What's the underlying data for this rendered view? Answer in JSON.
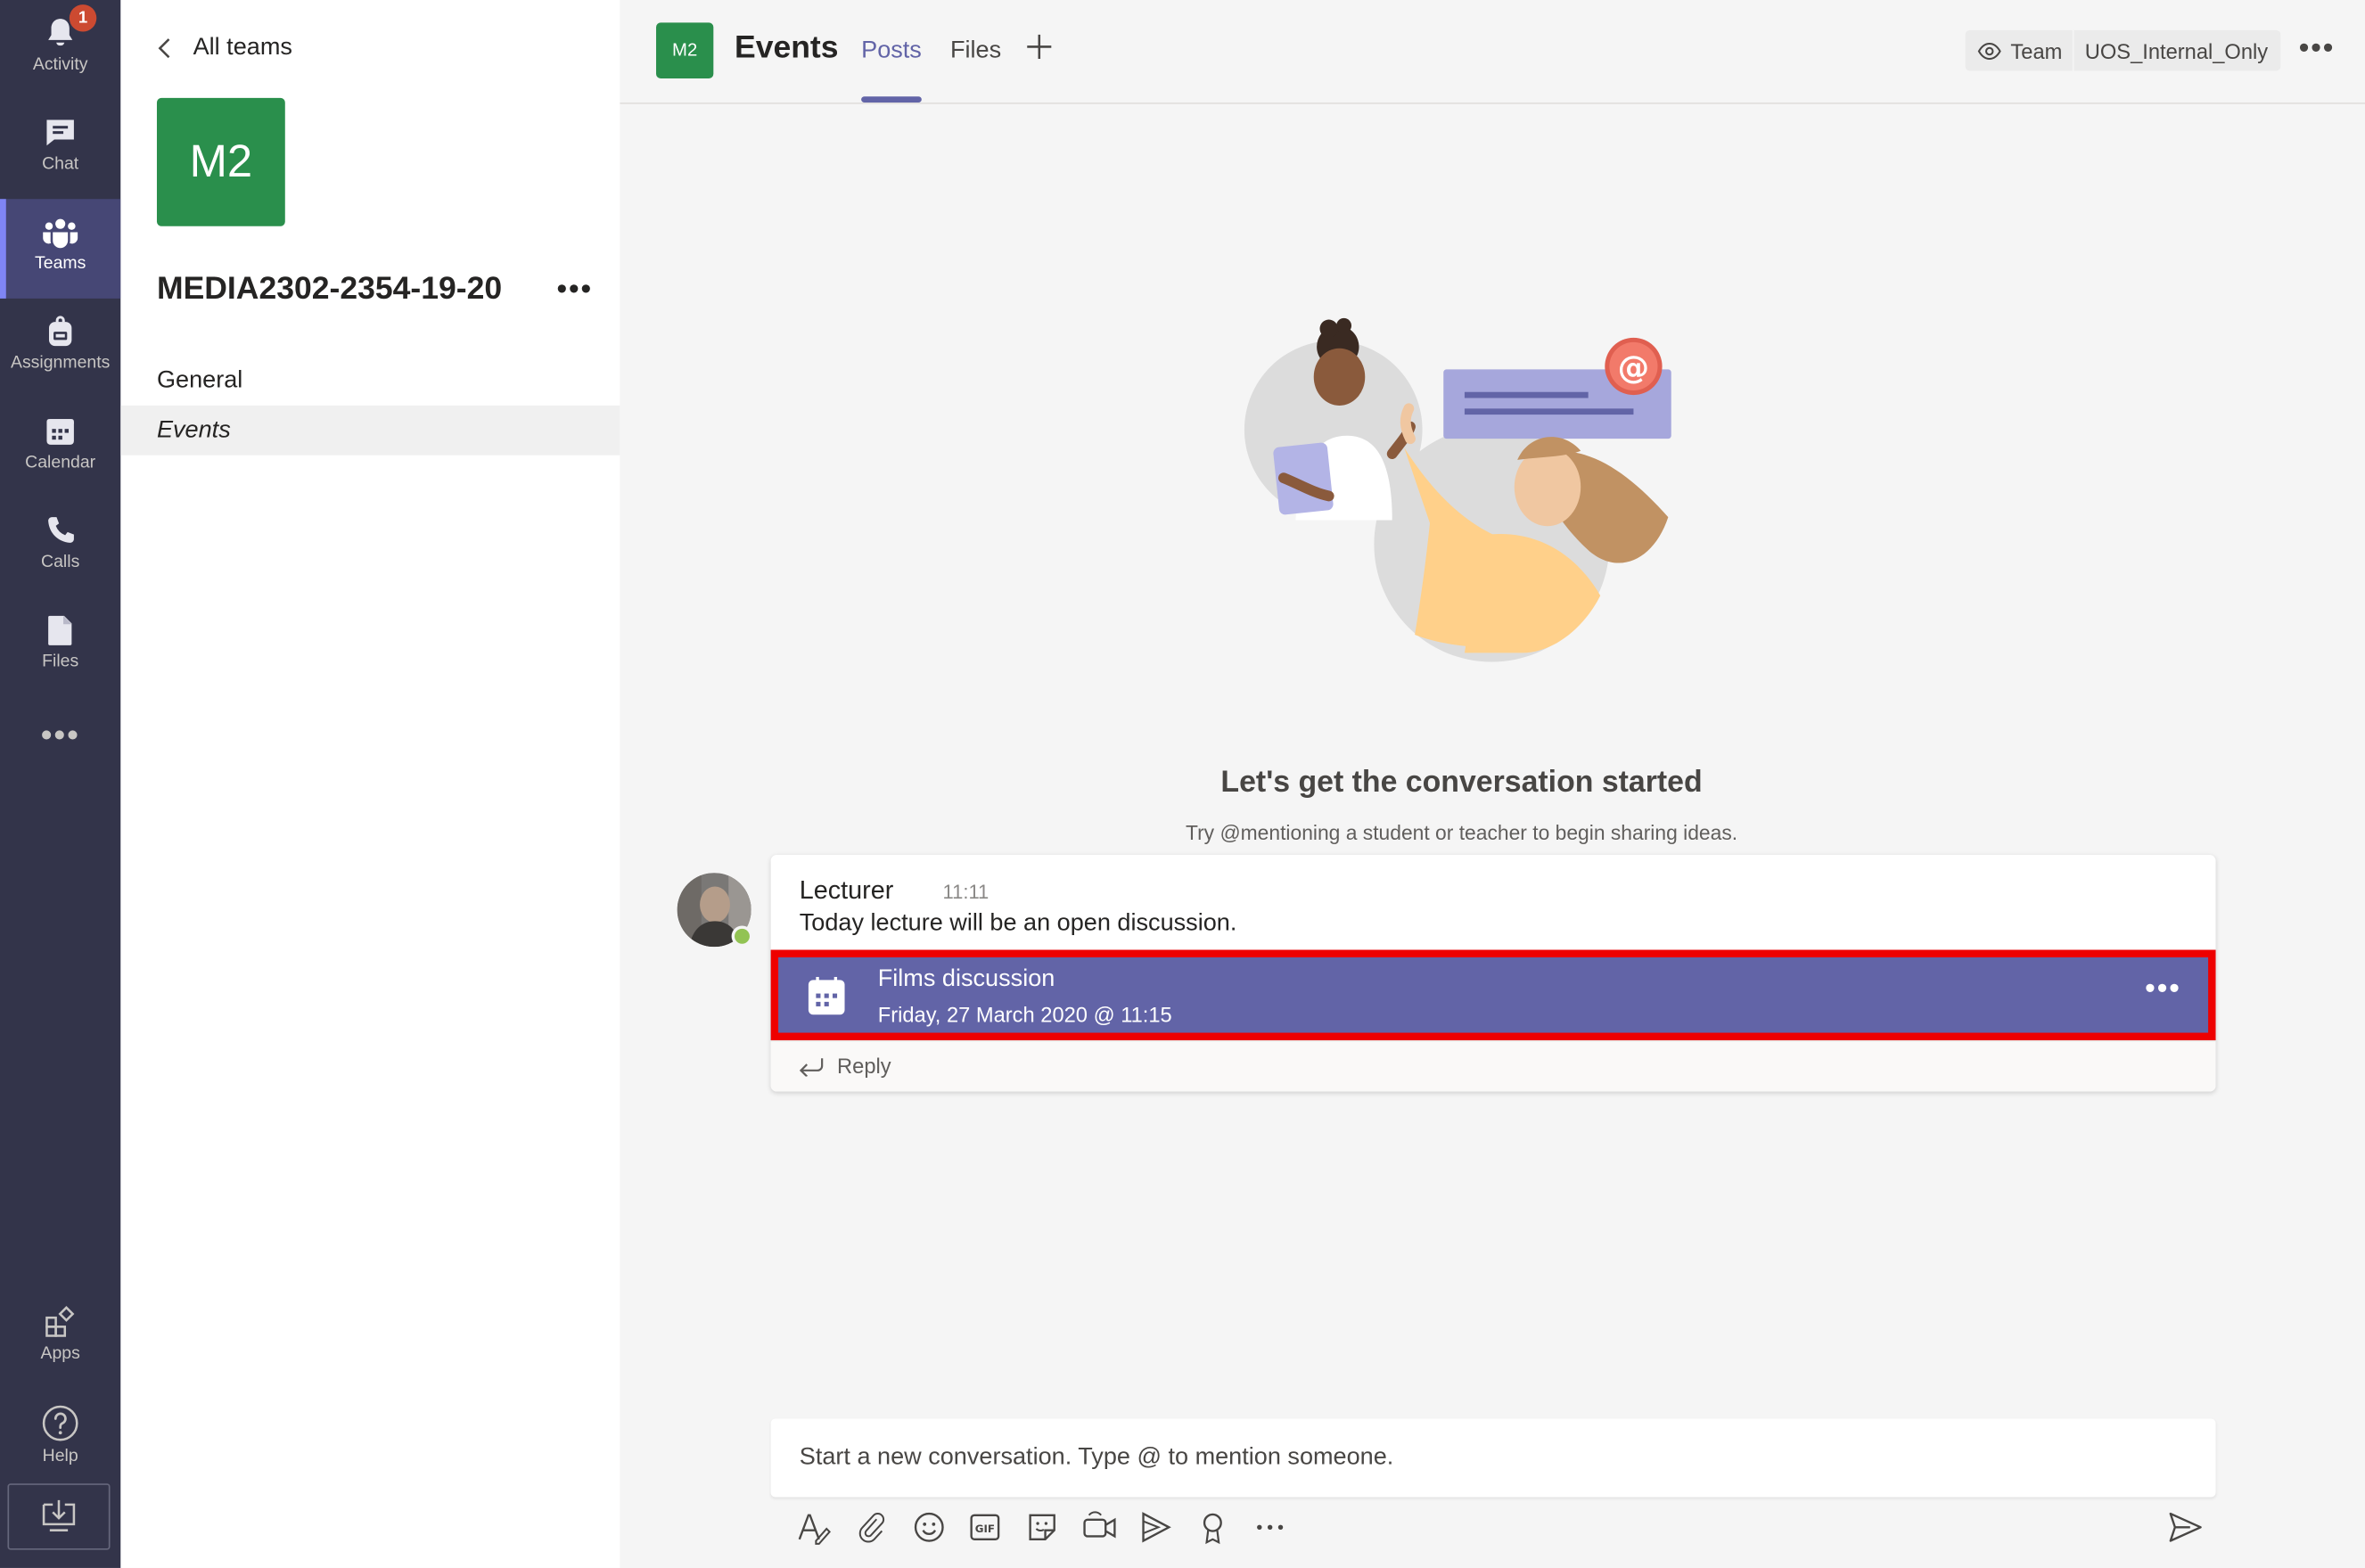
{
  "rail": {
    "items": [
      {
        "label": "Activity",
        "icon": "bell-icon",
        "badge": "1"
      },
      {
        "label": "Chat",
        "icon": "chat-icon"
      },
      {
        "label": "Teams",
        "icon": "teams-icon",
        "active": true
      },
      {
        "label": "Assignments",
        "icon": "backpack-icon"
      },
      {
        "label": "Calendar",
        "icon": "calendar-icon"
      },
      {
        "label": "Calls",
        "icon": "phone-icon"
      },
      {
        "label": "Files",
        "icon": "file-icon"
      }
    ],
    "more": "•••",
    "apps_label": "Apps",
    "help_label": "Help"
  },
  "team": {
    "back_label": "All teams",
    "initials": "M2",
    "name": "MEDIA2302-2354-19-20",
    "more": "•••",
    "channels": [
      {
        "label": "General"
      },
      {
        "label": "Events",
        "active": true
      }
    ]
  },
  "header": {
    "initials": "M2",
    "title": "Events",
    "tabs": [
      {
        "label": "Posts",
        "active": true
      },
      {
        "label": "Files"
      }
    ],
    "privacy_label": "Team",
    "privacy_value": "UOS_Internal_Only",
    "more": "•••"
  },
  "empty_state": {
    "title": "Let's get the conversation started",
    "subtitle": "Try @mentioning a student or teacher to begin sharing ideas."
  },
  "post": {
    "author": "Lecturer",
    "time": "11:11",
    "body": "Today lecture will be an open discussion.",
    "event": {
      "title": "Films discussion",
      "date": "Friday, 27 March 2020 @ 11:15",
      "more": "•••"
    },
    "reply_label": "Reply"
  },
  "compose": {
    "placeholder": "Start a new conversation. Type @ to mention someone."
  },
  "colors": {
    "rail": "#33344a",
    "brand": "#6264a7",
    "team_avatar": "#2a8f4c",
    "highlight": "#ee0000",
    "badge": "#cc4a31"
  }
}
